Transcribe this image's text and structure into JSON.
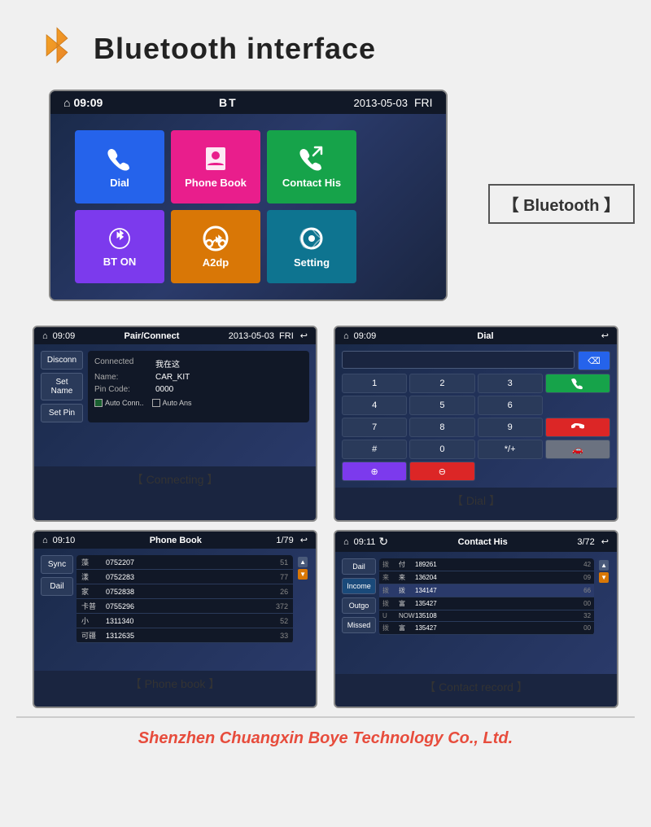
{
  "header": {
    "title": "Bluetooth interface"
  },
  "main_screen": {
    "time": "09:09",
    "label": "BT",
    "date": "2013-05-03",
    "day": "FRI"
  },
  "menu_tiles": [
    {
      "id": "dial",
      "label": "Dial",
      "color": "tile-blue",
      "icon": "📞"
    },
    {
      "id": "phone-book",
      "label": "Phone Book",
      "color": "tile-pink",
      "icon": "👤"
    },
    {
      "id": "contact-his",
      "label": "Contact His",
      "color": "tile-green",
      "icon": "📋"
    },
    {
      "id": "bt-on",
      "label": "BT ON",
      "color": "tile-purple",
      "icon": "⚙"
    },
    {
      "id": "a2dp",
      "label": "A2dp",
      "color": "tile-orange",
      "icon": "🎧"
    },
    {
      "id": "setting",
      "label": "Setting",
      "color": "tile-teal",
      "icon": "⚙"
    }
  ],
  "bluetooth_label": "【 Bluetooth 】",
  "connecting_screen": {
    "time": "09:09",
    "label": "Pair/Connect",
    "date": "2013-05-03",
    "day": "FRI",
    "buttons": [
      "Disconn",
      "Set Name",
      "Set Pin"
    ],
    "status": "Connected",
    "status_value": "我在这",
    "name_label": "Name:",
    "name_value": "CAR_KIT",
    "pin_label": "Pin Code:",
    "pin_value": "0000",
    "auto_conn": "Auto Conn..",
    "auto_ans": "Auto Ans",
    "caption": "【 Connecting 】"
  },
  "dial_screen": {
    "time": "09:09",
    "label": "Dial",
    "buttons": [
      "1",
      "2",
      "3",
      "4",
      "5",
      "6",
      "7",
      "8",
      "9",
      "#",
      "0",
      "*/+"
    ],
    "caption": "【 Dial 】"
  },
  "phonebook_screen": {
    "time": "09:10",
    "label": "Phone Book",
    "page": "1/79",
    "side_buttons": [
      "Sync",
      "Dail"
    ],
    "entries": [
      {
        "name": "藻",
        "number": "0752207",
        "idx": "51"
      },
      {
        "name": "漾",
        "number": "0752283",
        "idx": "77"
      },
      {
        "name": "家",
        "number": "0752838",
        "idx": "26"
      },
      {
        "name": "卡普",
        "number": "0755296",
        "idx": "372"
      },
      {
        "name": "小",
        "number": "1311340",
        "idx": "52"
      },
      {
        "name": "可疆",
        "number": "1312635",
        "idx": "33"
      }
    ],
    "caption": "【 Phone book 】"
  },
  "contact_screen": {
    "time": "09:11",
    "label": "Contact His",
    "page": "3/72",
    "side_buttons": [
      "Dail",
      "Income",
      "Outgo",
      "Missed"
    ],
    "entries": [
      {
        "type": "拨",
        "name": "付",
        "number": "189261",
        "dur": "42"
      },
      {
        "type": "来",
        "name": "来",
        "number": "136204",
        "dur": "09"
      },
      {
        "type": "拨",
        "name": "拨",
        "number": "134147",
        "dur": "66"
      },
      {
        "type": "拨",
        "name": "富",
        "number": "135427",
        "dur": "00"
      },
      {
        "type": "U",
        "name": "NOWN",
        "number": "135108",
        "dur": "32"
      },
      {
        "type": "拨",
        "name": "富",
        "number": "135427",
        "dur": "00"
      }
    ],
    "caption": "【 Contact record 】"
  },
  "footer": {
    "text": "Shenzhen Chuangxin Boye Technology Co., Ltd."
  }
}
